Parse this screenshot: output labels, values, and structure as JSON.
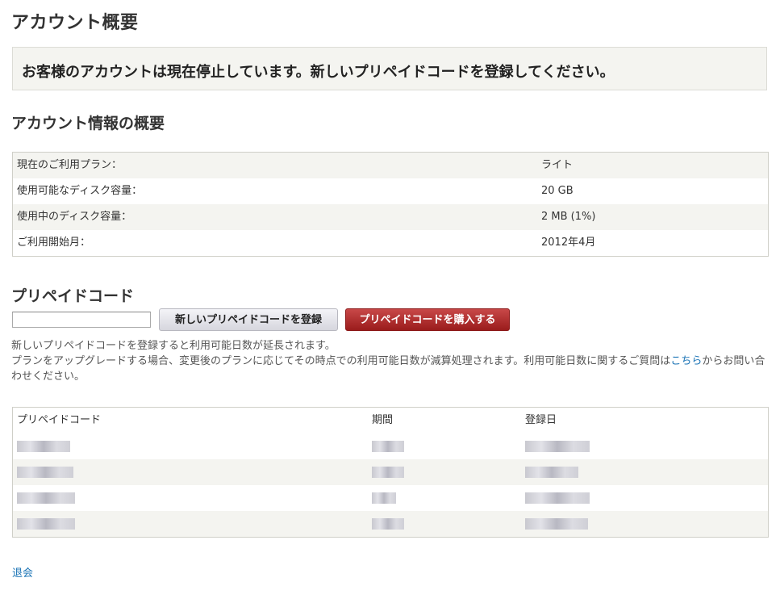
{
  "page_title": "アカウント概要",
  "notice": "お客様のアカウントは現在停止しています。新しいプリペイドコードを登録してください。",
  "account_summary": {
    "title": "アカウント情報の概要",
    "rows": [
      {
        "label": "現在のご利用プラン：",
        "value": "ライト"
      },
      {
        "label": "使用可能なディスク容量：",
        "value": "20 GB"
      },
      {
        "label": "使用中のディスク容量：",
        "value": "2 MB (1%)"
      },
      {
        "label": "ご利用開始月：",
        "value": "2012年4月"
      }
    ]
  },
  "prepaid": {
    "title": "プリペイドコード",
    "input_value": "",
    "register_button": "新しいプリペイドコードを登録",
    "buy_button": "プリペイドコードを購入する",
    "help_line1": "新しいプリペイドコードを登録すると利用可能日数が延長されます。",
    "help_line2_before": "プランをアップグレードする場合、変更後のプランに応じてその時点での利用可能日数が減算処理されます。利用可能日数に関するご質問は",
    "help_link": "こちら",
    "help_line2_after": "からお問い合わせください。",
    "table": {
      "headers": [
        "プリペイドコード",
        "期間",
        "登録日"
      ]
    }
  },
  "withdraw_link": "退会"
}
